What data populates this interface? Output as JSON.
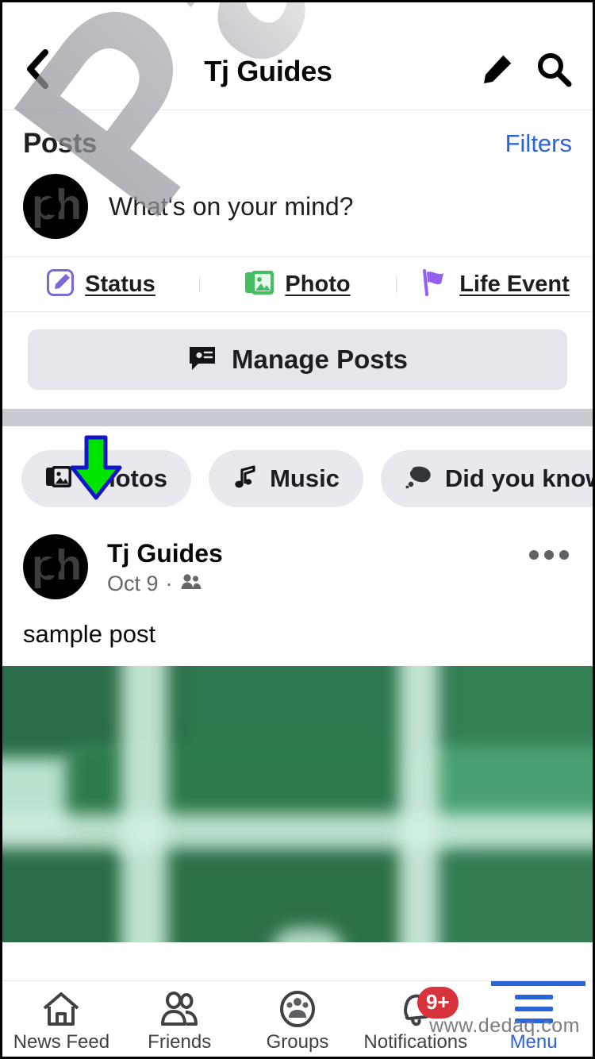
{
  "header": {
    "title": "Tj Guides",
    "back_icon": "chevron-left-icon",
    "edit_icon": "pencil-icon",
    "search_icon": "search-icon"
  },
  "posts_section": {
    "title": "Posts",
    "filters_label": "Filters"
  },
  "composer": {
    "avatar_text": "ph",
    "placeholder": "What's on your mind?"
  },
  "composer_actions": [
    {
      "label": "Status",
      "icon": "pencil-square-icon",
      "color": "#7e68d4"
    },
    {
      "label": "Photo",
      "icon": "photo-icon",
      "color": "#45bd62"
    },
    {
      "label": "Life Event",
      "icon": "flag-icon",
      "color": "#9360f7"
    }
  ],
  "manage_posts": {
    "label": "Manage Posts",
    "icon": "comment-lines-icon"
  },
  "chips": [
    {
      "label": "Photos",
      "icon": "photo-icon"
    },
    {
      "label": "Music",
      "icon": "music-note-icon"
    },
    {
      "label": "Did you know",
      "icon": "thought-bubble-icon"
    }
  ],
  "post": {
    "avatar_text": "ph",
    "author": "Tj Guides",
    "date": "Oct 9",
    "separator_dot": "·",
    "privacy_icon": "friends-icon",
    "menu_icon": "ellipsis-icon",
    "text": "sample post",
    "photo_alt": "blurred-green-keyboard-keys"
  },
  "bottom_nav": [
    {
      "label": "News Feed",
      "icon": "home-icon",
      "active": false,
      "badge": ""
    },
    {
      "label": "Friends",
      "icon": "friends-icon",
      "active": false,
      "badge": ""
    },
    {
      "label": "Groups",
      "icon": "groups-icon",
      "active": false,
      "badge": ""
    },
    {
      "label": "Notifications",
      "icon": "bell-icon",
      "active": false,
      "badge": "9+"
    },
    {
      "label": "Menu",
      "icon": "hamburger-icon",
      "active": true,
      "badge": ""
    }
  ],
  "watermarks": {
    "big_text": "Paphm",
    "small_text": "www.dedaq.com"
  },
  "annotation": {
    "arrow": "down-arrow-annotation",
    "fill": "#00E500",
    "stroke": "#1414C8"
  },
  "colors": {
    "accent_blue": "#2b63d9",
    "badge_red": "#d8323c",
    "chip_bg": "#e7e9ee",
    "separator": "#c8cbd1",
    "text_primary": "#080809",
    "text_secondary": "#65676b"
  }
}
